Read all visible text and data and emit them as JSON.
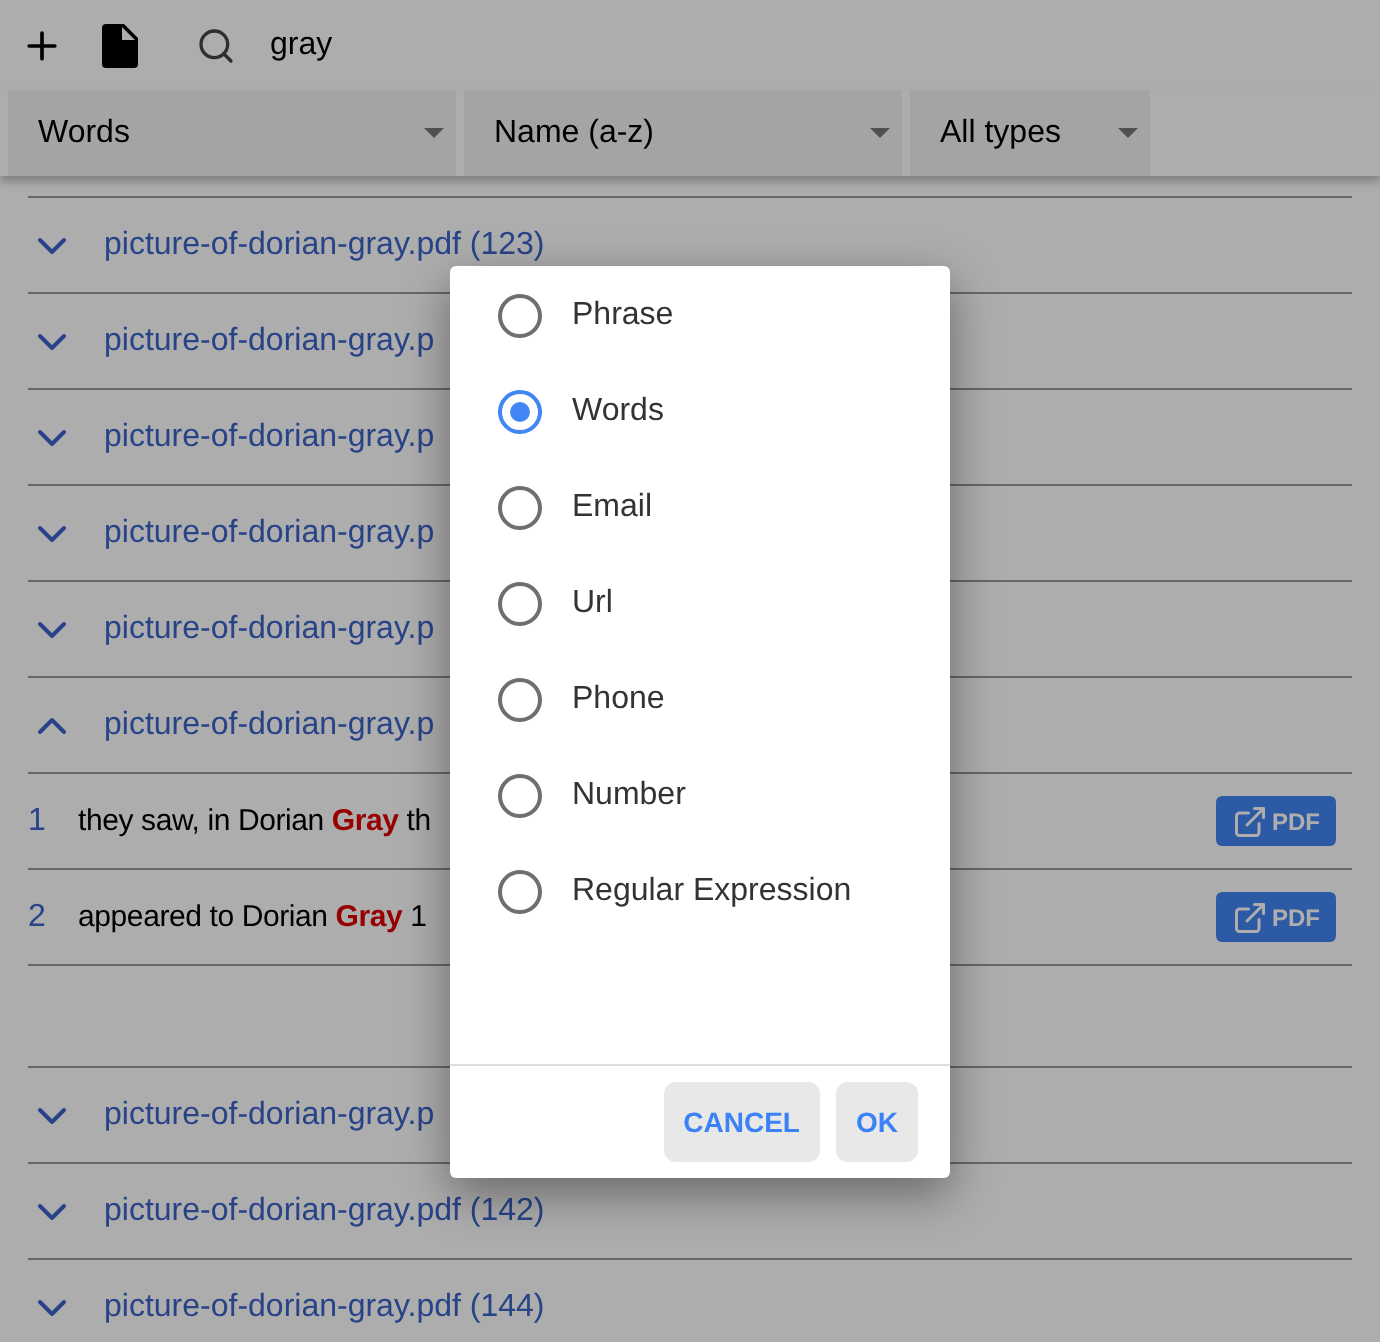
{
  "toolbar": {
    "search_value": "gray"
  },
  "filters": [
    {
      "label": "Words"
    },
    {
      "label": "Name (a-z)"
    },
    {
      "label": "All types"
    }
  ],
  "results": [
    {
      "title": "picture-of-dorian-gray.pdf (123)",
      "expanded": false
    },
    {
      "title": "picture-of-dorian-gray.p",
      "expanded": false
    },
    {
      "title": "picture-of-dorian-gray.p",
      "expanded": false
    },
    {
      "title": "picture-of-dorian-gray.p",
      "expanded": false
    },
    {
      "title": "picture-of-dorian-gray.p",
      "expanded": false
    },
    {
      "title": "picture-of-dorian-gray.p",
      "expanded": true,
      "matches": [
        {
          "number": "1",
          "text": "they saw, in Dorian **Gray** th",
          "button": "PDF"
        },
        {
          "number": "2",
          "text": "appeared to Dorian **Gray** 1",
          "button": "PDF"
        }
      ]
    },
    {
      "title": "picture-of-dorian-gray.p",
      "expanded": false
    },
    {
      "title": "picture-of-dorian-gray.pdf (142)",
      "expanded": false
    },
    {
      "title": "picture-of-dorian-gray.pdf (144)",
      "expanded": false
    }
  ],
  "dialog": {
    "options": [
      {
        "label": "Phrase",
        "selected": false
      },
      {
        "label": "Words",
        "selected": true
      },
      {
        "label": "Email",
        "selected": false
      },
      {
        "label": "Url",
        "selected": false
      },
      {
        "label": "Phone",
        "selected": false
      },
      {
        "label": "Number",
        "selected": false
      },
      {
        "label": "Regular Expression",
        "selected": false
      }
    ],
    "buttons": [
      "CANCEL",
      "OK"
    ]
  }
}
